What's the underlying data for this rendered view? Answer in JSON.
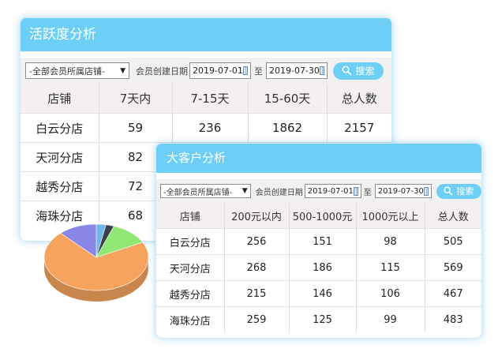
{
  "activity": {
    "title": "活跃度分析",
    "store_select": "-全部会员所属店铺-",
    "date_label": "会员创建日期",
    "start_date": "2019-07-01",
    "to_label": "至",
    "end_date": "2019-07-30",
    "search_label": "搜索",
    "columns": [
      "店铺",
      "7天内",
      "7-15天",
      "15-60天",
      "总人数"
    ],
    "rows": [
      [
        "白云分店",
        "59",
        "236",
        "1862",
        "2157"
      ],
      [
        "天河分店",
        "82",
        "",
        "",
        ""
      ],
      [
        "越秀分店",
        "72",
        "",
        "",
        ""
      ],
      [
        "海珠分店",
        "68",
        "",
        "",
        ""
      ]
    ]
  },
  "big_customer": {
    "title": "大客户分析",
    "store_select": "-全部会员所属店铺-",
    "date_label": "会员创建日期",
    "start_date": "2019-07-01",
    "to_label": "至",
    "end_date": "2019-07-30",
    "search_label": "搜索",
    "columns": [
      "店铺",
      "200元以内",
      "500-1000元",
      "1000元以上",
      "总人数"
    ],
    "rows": [
      [
        "白云分店",
        "256",
        "151",
        "98",
        "505"
      ],
      [
        "天河分店",
        "268",
        "186",
        "115",
        "569"
      ],
      [
        "越秀分店",
        "215",
        "146",
        "106",
        "467"
      ],
      [
        "海珠分店",
        "259",
        "125",
        "99",
        "483"
      ]
    ]
  },
  "pie": {
    "slices": [
      {
        "share": 0.03,
        "color": "#6fb6ee"
      },
      {
        "share": 0.025,
        "color": "#3a3f49"
      },
      {
        "share": 0.12,
        "color": "#8fe873"
      },
      {
        "share": 0.705,
        "color": "#f5a35d"
      },
      {
        "share": 0.12,
        "color": "#8a86e6"
      }
    ]
  }
}
